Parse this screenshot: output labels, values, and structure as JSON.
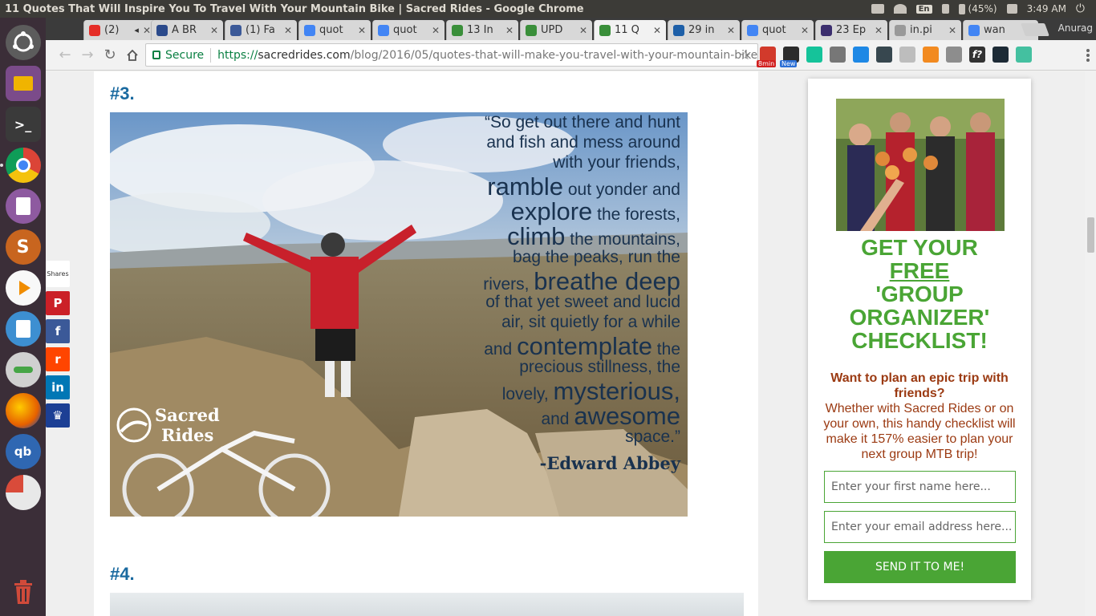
{
  "system": {
    "window_title": "11 Quotes That Will Inspire You To Travel With Your Mountain Bike | Sacred Rides - Google Chrome",
    "keyboard": "En",
    "battery": "(45%)",
    "clock": "3:49 AM",
    "user": "Anurag"
  },
  "launcher": [
    "ubuntu-icon",
    "files-icon",
    "terminal-icon",
    "chrome-icon",
    "document-viewer-icon",
    "sublime-icon",
    "vlc-icon",
    "text-editor-icon",
    "settings-icon",
    "firefox-icon",
    "qbittorrent-icon",
    "disk-usage-icon",
    "trash-icon"
  ],
  "tabs": [
    {
      "label": "(2)",
      "favicon": "youtube-icon",
      "color": "#e52d27",
      "audio": true
    },
    {
      "label": "A BR",
      "favicon": "crown-icon",
      "color": "#2b4a8b"
    },
    {
      "label": "(1) Fa",
      "favicon": "facebook-icon",
      "color": "#3b5998"
    },
    {
      "label": "quot",
      "favicon": "google-icon",
      "color": "#4285f4"
    },
    {
      "label": "quot",
      "favicon": "google-icon",
      "color": "#4285f4"
    },
    {
      "label": "13 In",
      "favicon": "sacred-rides-icon",
      "color": "#3a8f3a"
    },
    {
      "label": "UPD",
      "favicon": "sacred-rides-icon",
      "color": "#3a8f3a"
    },
    {
      "label": "11 Q",
      "favicon": "sacred-rides-icon",
      "color": "#3a8f3a",
      "active": true
    },
    {
      "label": "29 in",
      "favicon": "globe-icon",
      "color": "#1d5fa8"
    },
    {
      "label": "quot",
      "favicon": "google-icon",
      "color": "#4285f4"
    },
    {
      "label": "23 Ep",
      "favicon": "m-icon",
      "color": "#3b2e6e"
    },
    {
      "label": "in.pi",
      "favicon": "page-icon",
      "color": "#999999"
    },
    {
      "label": "wan",
      "favicon": "google-icon",
      "color": "#4285f4"
    }
  ],
  "address": {
    "secure_label": "Secure",
    "scheme": "https://",
    "domain": "sacredrides.com",
    "path": "/blog/2016/05/quotes-that-will-make-you-travel-with-your-mountain-bike"
  },
  "extensions": [
    {
      "name": "timer-extension-icon",
      "color": "#d23a2b",
      "badge": "8min",
      "badge_color": "#d21f1f"
    },
    {
      "name": "dark-extension-icon",
      "color": "#2c2c2c",
      "badge": "New",
      "badge_color": "#2b6fd6"
    },
    {
      "name": "grammarly-icon",
      "color": "#15c39a"
    },
    {
      "name": "puzzle-extension-icon",
      "color": "#777777"
    },
    {
      "name": "window-extension-icon",
      "color": "#1e88e5"
    },
    {
      "name": "toolbar-extension-icon",
      "color": "#37474f"
    },
    {
      "name": "layers-extension-icon",
      "color": "#bdbdbd"
    },
    {
      "name": "fox-extension-icon",
      "color": "#f28a20"
    },
    {
      "name": "inbox-extension-icon",
      "color": "#8d8d8d"
    },
    {
      "name": "function-extension-icon",
      "color": "#333333",
      "glyph": "f?"
    },
    {
      "name": "react-extension-icon",
      "color": "#1d2b36"
    },
    {
      "name": "circle-extension-icon",
      "color": "#44c0a0"
    }
  ],
  "article": {
    "heading3": "#3.",
    "heading4": "#4.",
    "quote_lines": [
      {
        "parts": [
          {
            "t": "“So get out there and hunt",
            "s": 21
          }
        ]
      },
      {
        "parts": [
          {
            "t": "and fish and mess around",
            "s": 21
          }
        ]
      },
      {
        "parts": [
          {
            "t": "with your friends,",
            "s": 21
          }
        ]
      },
      {
        "parts": [
          {
            "t": "ramble",
            "s": 31
          },
          {
            "t": " out yonder and",
            "s": 21
          }
        ]
      },
      {
        "parts": [
          {
            "t": "explore",
            "s": 31
          },
          {
            "t": " the forests,",
            "s": 21
          }
        ]
      },
      {
        "parts": [
          {
            "t": "climb",
            "s": 31
          },
          {
            "t": " the mountains,",
            "s": 21
          }
        ]
      },
      {
        "parts": [
          {
            "t": "bag the peaks, run the",
            "s": 21
          }
        ]
      },
      {
        "parts": [
          {
            "t": "rivers, ",
            "s": 21
          },
          {
            "t": "breathe deep",
            "s": 31
          }
        ]
      },
      {
        "parts": [
          {
            "t": "of that yet sweet and lucid",
            "s": 21
          }
        ]
      },
      {
        "parts": [
          {
            "t": "air, sit quietly for a while",
            "s": 21
          }
        ]
      },
      {
        "parts": [
          {
            "t": "and ",
            "s": 21
          },
          {
            "t": "contemplate",
            "s": 31
          },
          {
            "t": " the",
            "s": 21
          }
        ]
      },
      {
        "parts": [
          {
            "t": "precious stillness, the",
            "s": 21
          }
        ]
      },
      {
        "parts": [
          {
            "t": "lovely, ",
            "s": 21
          },
          {
            "t": "mysterious,",
            "s": 31
          }
        ]
      },
      {
        "parts": [
          {
            "t": "and ",
            "s": 21
          },
          {
            "t": "awesome",
            "s": 31
          }
        ]
      },
      {
        "parts": [
          {
            "t": "space.”",
            "s": 21
          }
        ]
      }
    ],
    "quote_author": "-Edward Abbey",
    "brand_line1": "Sacred",
    "brand_line2": "Rides"
  },
  "share": {
    "label": "Shares",
    "buttons": [
      {
        "name": "pinterest-share-button",
        "glyph": "P",
        "color": "#cb2027"
      },
      {
        "name": "facebook-share-button",
        "glyph": "f",
        "color": "#3b5998"
      },
      {
        "name": "reddit-share-button",
        "glyph": "r",
        "color": "#ff4500"
      },
      {
        "name": "linkedin-share-button",
        "glyph": "in",
        "color": "#0077b5"
      },
      {
        "name": "crown-share-button",
        "glyph": "♛",
        "color": "#1c3f94"
      }
    ]
  },
  "widget": {
    "cta_line1": "GET YOUR",
    "cta_line2": "FREE",
    "cta_line3": "'GROUP",
    "cta_line4": "ORGANIZER'",
    "cta_line5": "CHECKLIST!",
    "question": "Want to plan an epic trip with friends?",
    "description": "Whether with Sacred Rides or on your own, this handy checklist will make it 157% easier to plan your next group MTB trip!",
    "first_name_placeholder": "Enter your first name here...",
    "email_placeholder": "Enter your email address here...",
    "submit_label": "SEND IT TO ME!",
    "accent_color": "#4aa535",
    "text_color": "#9b3a12"
  }
}
